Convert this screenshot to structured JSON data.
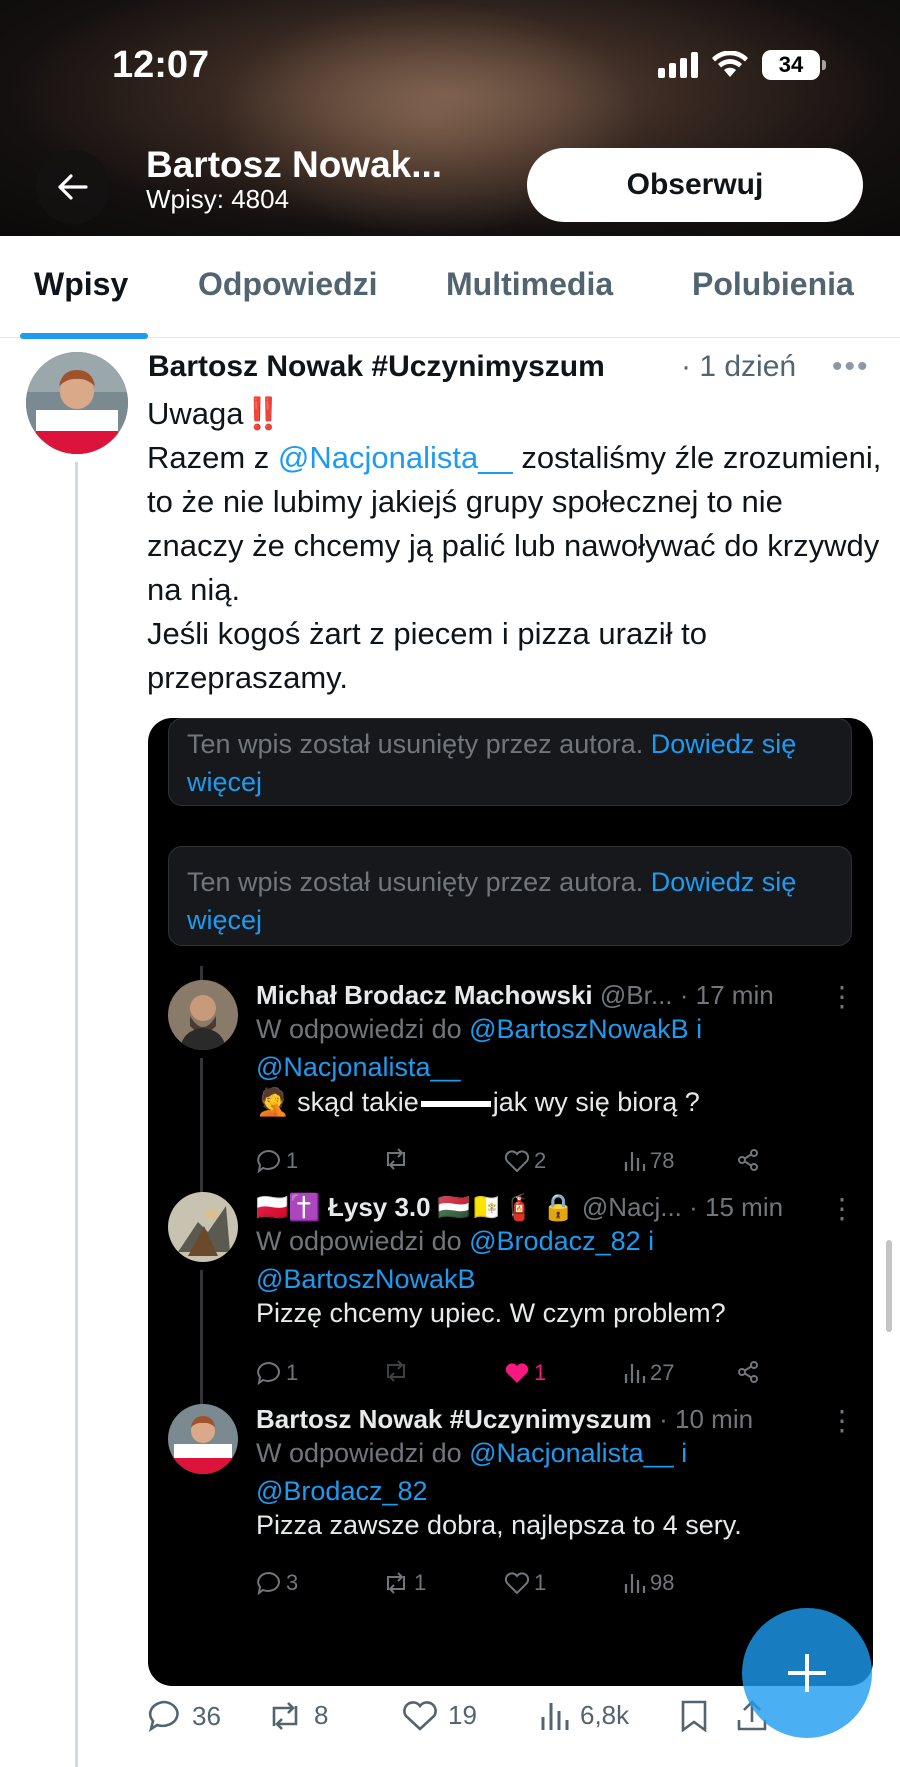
{
  "status_bar": {
    "time": "12:07",
    "battery": "34"
  },
  "profile": {
    "name": "Bartosz Nowak...",
    "posts_count": "Wpisy: 4804",
    "follow_label": "Obserwuj"
  },
  "tabs": [
    {
      "label": "Wpisy",
      "active": true
    },
    {
      "label": "Odpowiedzi",
      "active": false
    },
    {
      "label": "Multimedia",
      "active": false
    },
    {
      "label": "Polubienia",
      "active": false
    }
  ],
  "post": {
    "author": "Bartosz Nowak #Uczynimyszum",
    "time": "· 1 dzień",
    "line1": "Uwaga",
    "line1_emoji": "‼️",
    "line2_pre": "Razem z ",
    "line2_mention": "@Nacjonalista__",
    "line2_post": " zostaliśmy źle zrozumieni, to że nie lubimy jakiejś grupy społecznej to nie znaczy że chcemy ją palić lub nawoływać do krzywdy na nią.",
    "line3": "Jeśli kogoś żart z piecem i pizza uraził to przepraszamy.",
    "stats": {
      "replies": "36",
      "reposts": "8",
      "likes": "19",
      "views": "6,8k"
    }
  },
  "embed": {
    "deleted_text": "Ten wpis został usunięty przez autora.",
    "deleted_link": "Dowiedz się więcej",
    "replies": [
      {
        "name": "Michał Brodacz Machowski",
        "handle": "@Br...",
        "time": "· 17 min",
        "reply_to_prefix": "W odpowiedzi do",
        "reply_to_a": "@BartoszNowakB",
        "reply_to_join": "i",
        "reply_to_b": "@Nacjonalista__",
        "text_emoji": "🤦",
        "text_pre": "skąd takie",
        "text_post": "jak wy się biorą ?",
        "stats": {
          "replies": "1",
          "reposts": "",
          "likes": "2",
          "views": "78"
        }
      },
      {
        "name_prefix": "🇵🇱✝️",
        "name": "Łysy 3.0",
        "name_suffix": "🇭🇺🇻🇦🧯",
        "handle": "🔒 @Nacj...",
        "time": "· 15 min",
        "reply_to_prefix": "W odpowiedzi do",
        "reply_to_a": "@Brodacz_82",
        "reply_to_join": "i",
        "reply_to_b": "@BartoszNowakB",
        "text": "Pizzę chcemy upiec. W czym problem?",
        "stats": {
          "replies": "1",
          "reposts": "",
          "likes": "1",
          "views": "27"
        }
      },
      {
        "name": "Bartosz Nowak #Uczynimyszum",
        "time": "· 10 min",
        "reply_to_prefix": "W odpowiedzi do",
        "reply_to_a": "@Nacjonalista__",
        "reply_to_join": "i",
        "reply_to_b": "@Brodacz_82",
        "text": "Pizza zawsze dobra, najlepsza to 4 sery.",
        "stats": {
          "replies": "3",
          "reposts": "1",
          "likes": "1",
          "views": "98"
        }
      }
    ]
  },
  "colors": {
    "accent": "#1d9bf0",
    "like_active": "#f91880"
  },
  "icons": [
    "back-arrow-icon",
    "signal-icon",
    "wifi-icon",
    "battery-icon",
    "more-icon",
    "reply-icon",
    "repost-icon",
    "like-icon",
    "views-icon",
    "bookmark-icon",
    "share-icon",
    "compose-icon"
  ]
}
